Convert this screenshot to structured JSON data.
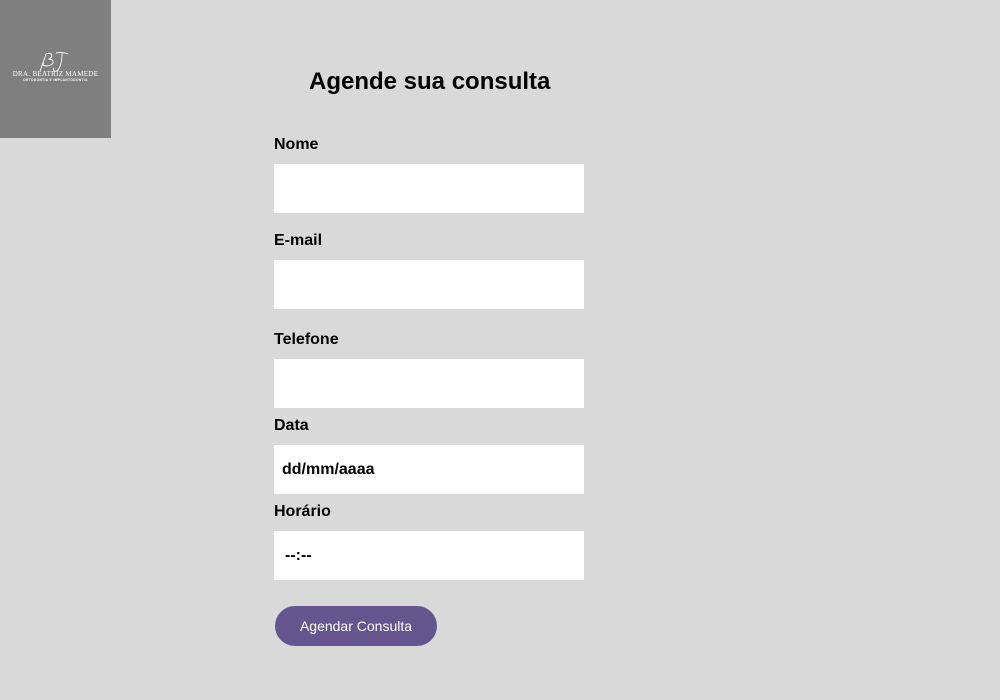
{
  "logo": {
    "name": "DRA. BEATRIZ MAMEDE",
    "subtitle": "ORTODONTIA E IMPLANTODONTIA",
    "background": "#7f7f7f"
  },
  "form": {
    "title": "Agende sua consulta",
    "fields": [
      {
        "label": "Nome",
        "value": "",
        "placeholder": ""
      },
      {
        "label": "E-mail",
        "value": "",
        "placeholder": ""
      },
      {
        "label": "Telefone",
        "value": "",
        "placeholder": ""
      },
      {
        "label": "Data",
        "value": "",
        "placeholder": "dd/mm/aaaa"
      },
      {
        "label": "Horário",
        "value": "",
        "placeholder": "--:--"
      }
    ],
    "submit_label": "Agendar Consulta"
  },
  "colors": {
    "page_background": "#d9d9d9",
    "input_background": "#ffffff",
    "button_background": "#65558f",
    "button_text": "#ffffff"
  }
}
